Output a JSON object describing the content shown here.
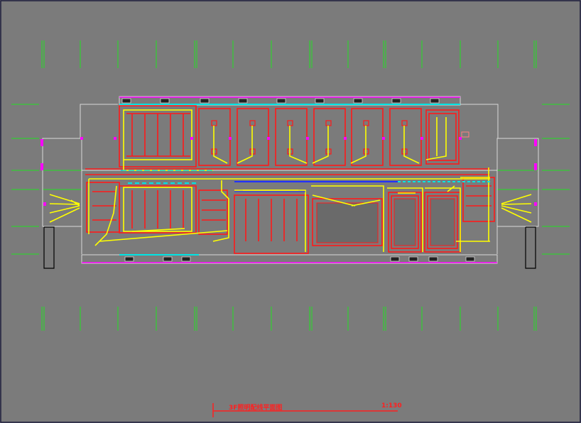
{
  "drawing": {
    "title": "3F照明配线平面图",
    "scale": "1:130"
  },
  "colors": {
    "background": "#7b7b7b",
    "frame": "#1c1c3c",
    "wall": "#ff1a1a",
    "wire": "#ffff00",
    "axis": "#20e020",
    "dim": "#ff00ff",
    "cyan": "#00e5e5",
    "blue": "#2030ff",
    "outline": "#d8d8d8",
    "title": "#ff2020"
  }
}
